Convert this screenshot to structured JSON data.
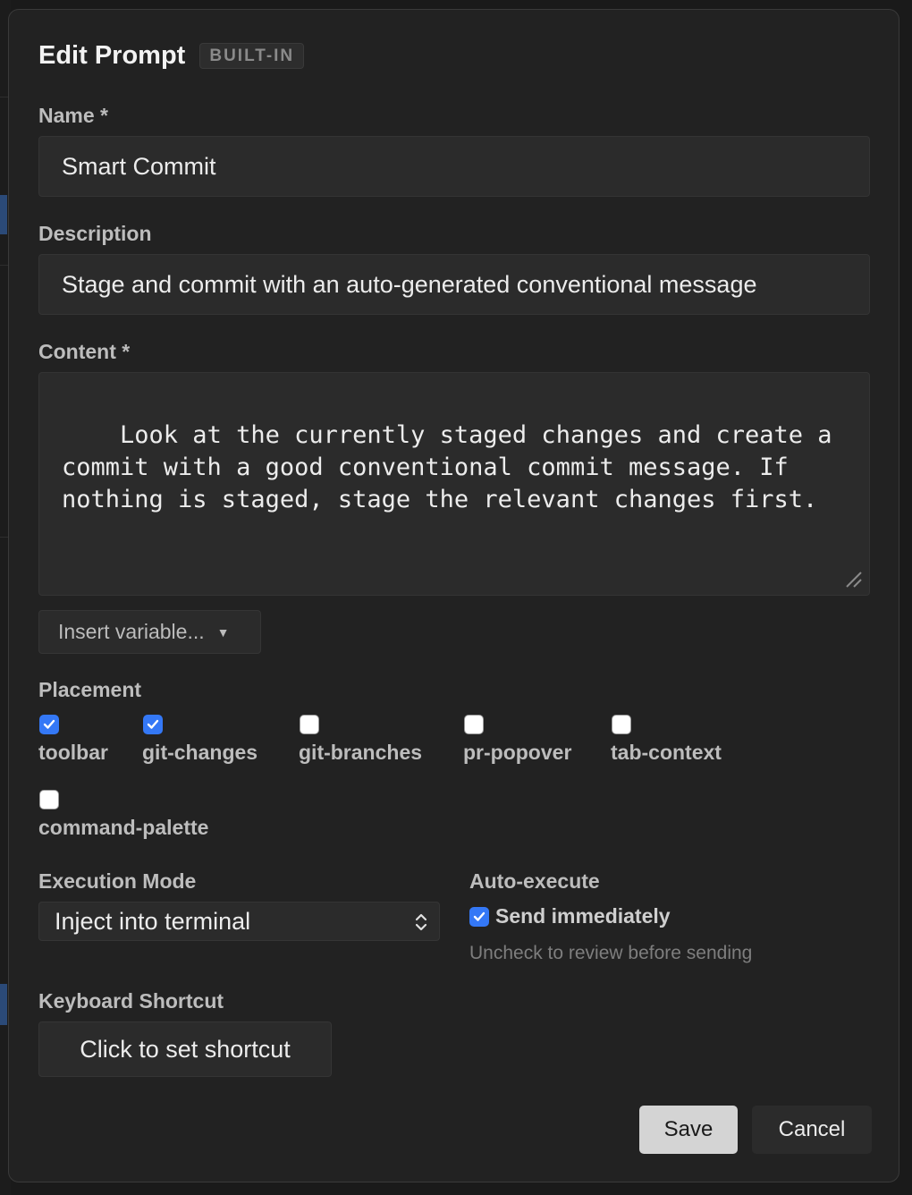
{
  "dialog": {
    "title": "Edit Prompt",
    "badge": "BUILT-IN"
  },
  "name": {
    "label": "Name *",
    "value": "Smart Commit"
  },
  "description": {
    "label": "Description",
    "value": "Stage and commit with an auto-generated conventional message"
  },
  "content": {
    "label": "Content *",
    "value": "Look at the currently staged changes and create a commit with a good conventional commit message. If nothing is staged, stage the relevant changes first."
  },
  "insert_variable": {
    "label": "Insert variable...",
    "caret": "▼"
  },
  "placement": {
    "label": "Placement",
    "items": [
      {
        "label": "toolbar",
        "checked": true
      },
      {
        "label": "git-changes",
        "checked": true
      },
      {
        "label": "git-branches",
        "checked": false
      },
      {
        "label": "pr-popover",
        "checked": false
      },
      {
        "label": "tab-context",
        "checked": false
      },
      {
        "label": "command-palette",
        "checked": false
      }
    ]
  },
  "execution_mode": {
    "label": "Execution Mode",
    "selected": "Inject into terminal"
  },
  "auto_execute": {
    "label": "Auto-execute",
    "option_label": "Send immediately",
    "checked": true,
    "hint": "Uncheck to review before sending"
  },
  "keyboard_shortcut": {
    "label": "Keyboard Shortcut",
    "button": "Click to set shortcut"
  },
  "actions": {
    "save": "Save",
    "cancel": "Cancel"
  },
  "colors": {
    "accent": "#3478f6",
    "background": "#222222",
    "field": "#2b2b2b"
  }
}
